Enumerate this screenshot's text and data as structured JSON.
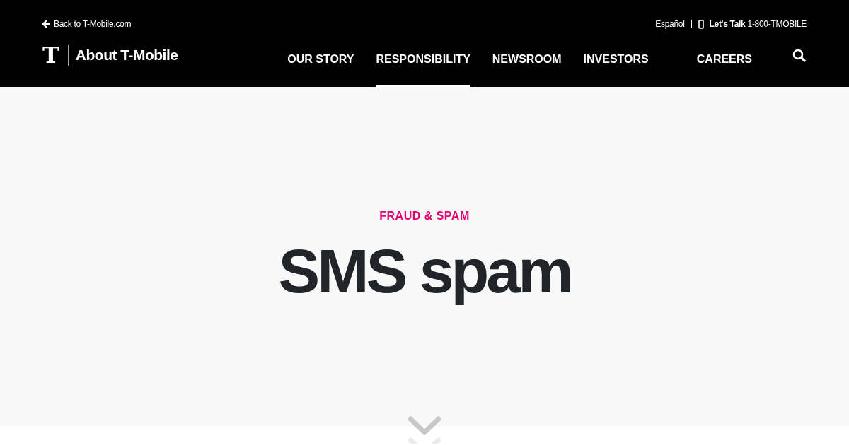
{
  "utility_bar": {
    "back_link": "Back to T-Mobile.com",
    "language_link": "Español",
    "phone_link": "**Let's Talk** 1-800-TMOBILE"
  },
  "header": {
    "logo_letter": "T",
    "site_title": "About T-Mobile"
  },
  "nav": [
    {
      "label": "OUR STORY",
      "selected": false
    },
    {
      "label": "RESPONSIBILITY",
      "selected": true
    },
    {
      "label": "NEWSROOM",
      "selected": false
    },
    {
      "label": "INVESTORS",
      "selected": false
    },
    {
      "label": "CAREERS",
      "selected": false
    }
  ],
  "hero": {
    "category": "FRAUD & SPAM",
    "title": "SMS spam"
  }
}
